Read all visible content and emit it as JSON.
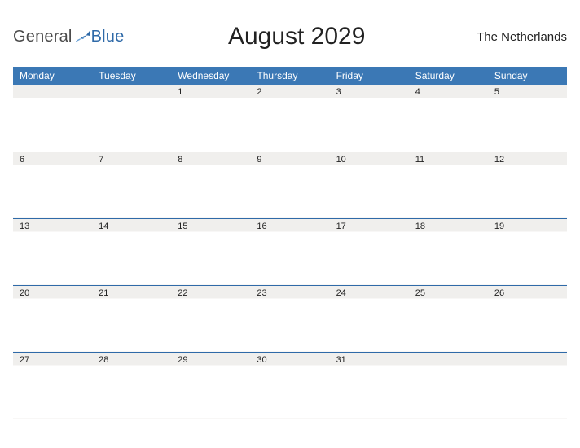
{
  "brand": {
    "part1": "General",
    "part2": "Blue"
  },
  "title": "August 2029",
  "region": "The Netherlands",
  "weekdays": [
    "Monday",
    "Tuesday",
    "Wednesday",
    "Thursday",
    "Friday",
    "Saturday",
    "Sunday"
  ],
  "weeks": [
    [
      "",
      "",
      "1",
      "2",
      "3",
      "4",
      "5"
    ],
    [
      "6",
      "7",
      "8",
      "9",
      "10",
      "11",
      "12"
    ],
    [
      "13",
      "14",
      "15",
      "16",
      "17",
      "18",
      "19"
    ],
    [
      "20",
      "21",
      "22",
      "23",
      "24",
      "25",
      "26"
    ],
    [
      "27",
      "28",
      "29",
      "30",
      "31",
      "",
      ""
    ]
  ]
}
